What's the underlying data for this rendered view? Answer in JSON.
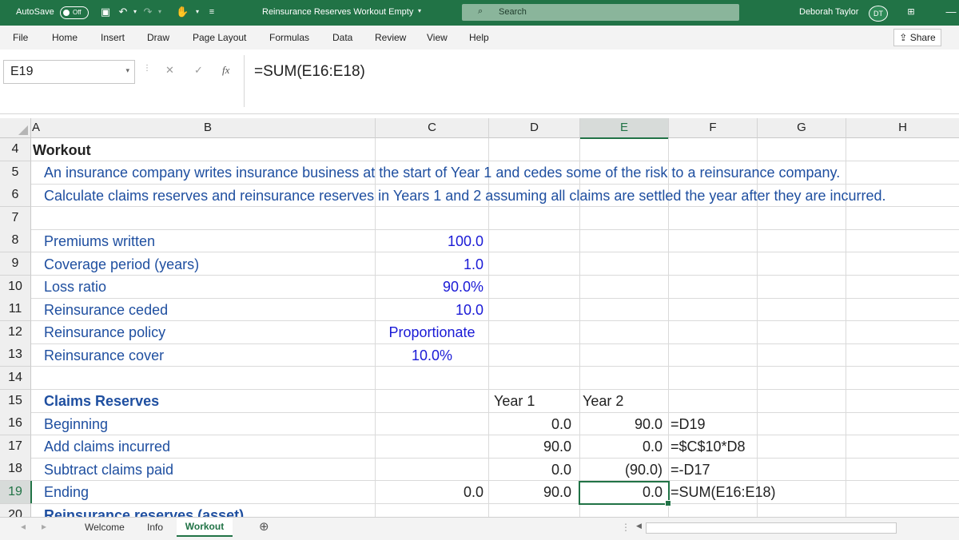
{
  "titlebar": {
    "autosave_label": "AutoSave",
    "autosave_state": "Off",
    "doc_title": "Reinsurance Reserves Workout Empty",
    "search_placeholder": "Search",
    "user_name": "Deborah Taylor",
    "user_initials": "DT",
    "bg_color": "#217346"
  },
  "ribbon": {
    "tabs": [
      "File",
      "Home",
      "Insert",
      "Draw",
      "Page Layout",
      "Formulas",
      "Data",
      "Review",
      "View",
      "Help"
    ],
    "share_label": "Share"
  },
  "formula_bar": {
    "name_box": "E19",
    "fx_label": "fx",
    "formula": "=SUM(E16:E18)"
  },
  "columns": [
    "A",
    "B",
    "C",
    "D",
    "E",
    "F",
    "G",
    "H"
  ],
  "rows": [
    "4",
    "5",
    "6",
    "7",
    "8",
    "9",
    "10",
    "11",
    "12",
    "13",
    "14",
    "15",
    "16",
    "17",
    "18",
    "19",
    "20"
  ],
  "cells": {
    "A4": "Workout",
    "B5": "An insurance company writes insurance business at the start of Year 1 and cedes some of the risk to a reinsurance company.",
    "B6": "Calculate claims reserves and reinsurance reserves in Years 1 and 2 assuming all claims are settled the year after they are incurred.",
    "B8": "Premiums written",
    "C8": "100.0",
    "B9": "Coverage period (years)",
    "C9": "1.0",
    "B10": "Loss ratio",
    "C10": "90.0%",
    "B11": "Reinsurance ceded",
    "C11": "10.0",
    "B12": "Reinsurance policy",
    "C12": "Proportionate",
    "B13": "Reinsurance cover",
    "C13": "10.0%",
    "B15": "Claims Reserves",
    "D15": "Year 1",
    "E15": "Year 2",
    "B16": "Beginning",
    "D16": "0.0",
    "E16": "90.0",
    "F16": "=D19",
    "B17": "Add claims incurred",
    "D17": "90.0",
    "E17": "0.0",
    "F17": "=$C$10*D8",
    "B18": "Subtract claims paid",
    "D18": "0.0",
    "E18": "(90.0)",
    "F18": "=-D17",
    "B19": "Ending",
    "C19": "0.0",
    "D19": "90.0",
    "E19": "0.0",
    "F19": "=SUM(E16:E18)",
    "B20": "Reinsurance reserves (asset)"
  },
  "sheet_tabs": [
    "Welcome",
    "Info",
    "Workout"
  ],
  "active_sheet": "Workout"
}
